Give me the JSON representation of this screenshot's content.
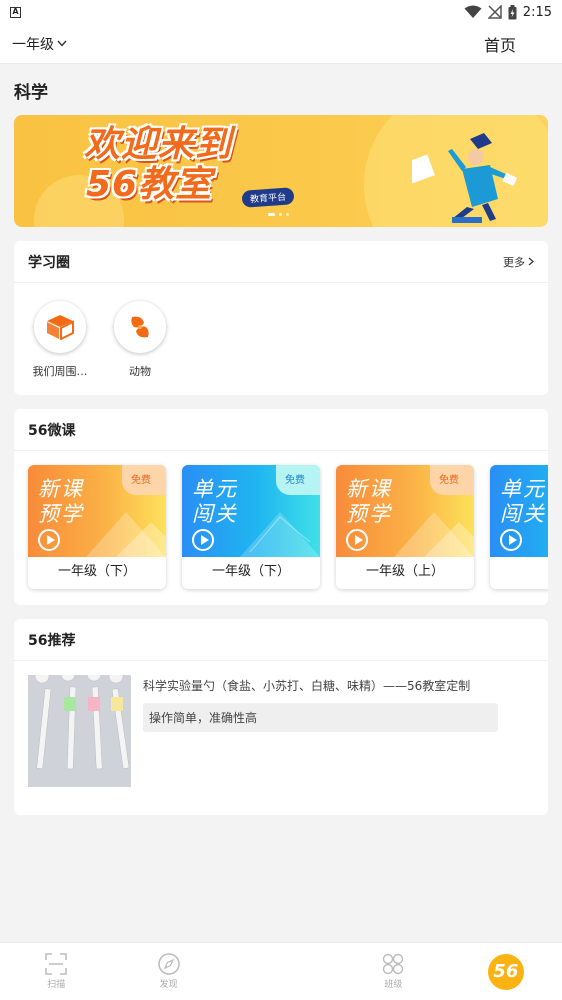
{
  "status_bar": {
    "time": "2:15",
    "notification_icon": "A"
  },
  "header": {
    "grade": "一年级",
    "title": "首页"
  },
  "subject": "科学",
  "banner": {
    "headline_line1": "欢迎来到",
    "headline_line2": "56教室",
    "tag": "教育平台",
    "colors": {
      "bg": "#f9c242",
      "headline": "#f26a1b",
      "tag_bg": "#1f3b8a"
    }
  },
  "study_circle": {
    "title": "学习圈",
    "more": "更多",
    "items": [
      {
        "label": "我们周围…",
        "icon": "cube-icon"
      },
      {
        "label": "动物",
        "icon": "fish-icon"
      }
    ]
  },
  "micro_courses": {
    "title": "56微课",
    "items": [
      {
        "line1": "新课",
        "line2": "预学",
        "badge": "免费",
        "label": "一年级（下）",
        "theme": "orange"
      },
      {
        "line1": "单元",
        "line2": "闯关",
        "badge": "免费",
        "label": "一年级（下）",
        "theme": "blue"
      },
      {
        "line1": "新课",
        "line2": "预学",
        "badge": "免费",
        "label": "一年级（上）",
        "theme": "orange"
      },
      {
        "line1": "单元",
        "line2": "闯关",
        "badge": "",
        "label": "一",
        "theme": "blue"
      }
    ]
  },
  "recommend": {
    "title": "56推荐",
    "item_title": "科学实验量勺（食盐、小苏打、白糖、味精）——56教室定制",
    "item_desc": "操作简单，准确性高"
  },
  "bottom_nav": {
    "items": [
      {
        "label": "扫描",
        "icon": "scan-icon"
      },
      {
        "label": "发现",
        "icon": "compass-icon"
      },
      {
        "label": "",
        "icon": "logo-56"
      },
      {
        "label": "班级",
        "icon": "grid-icon"
      },
      {
        "label": "56",
        "icon": "logo-56"
      }
    ]
  }
}
